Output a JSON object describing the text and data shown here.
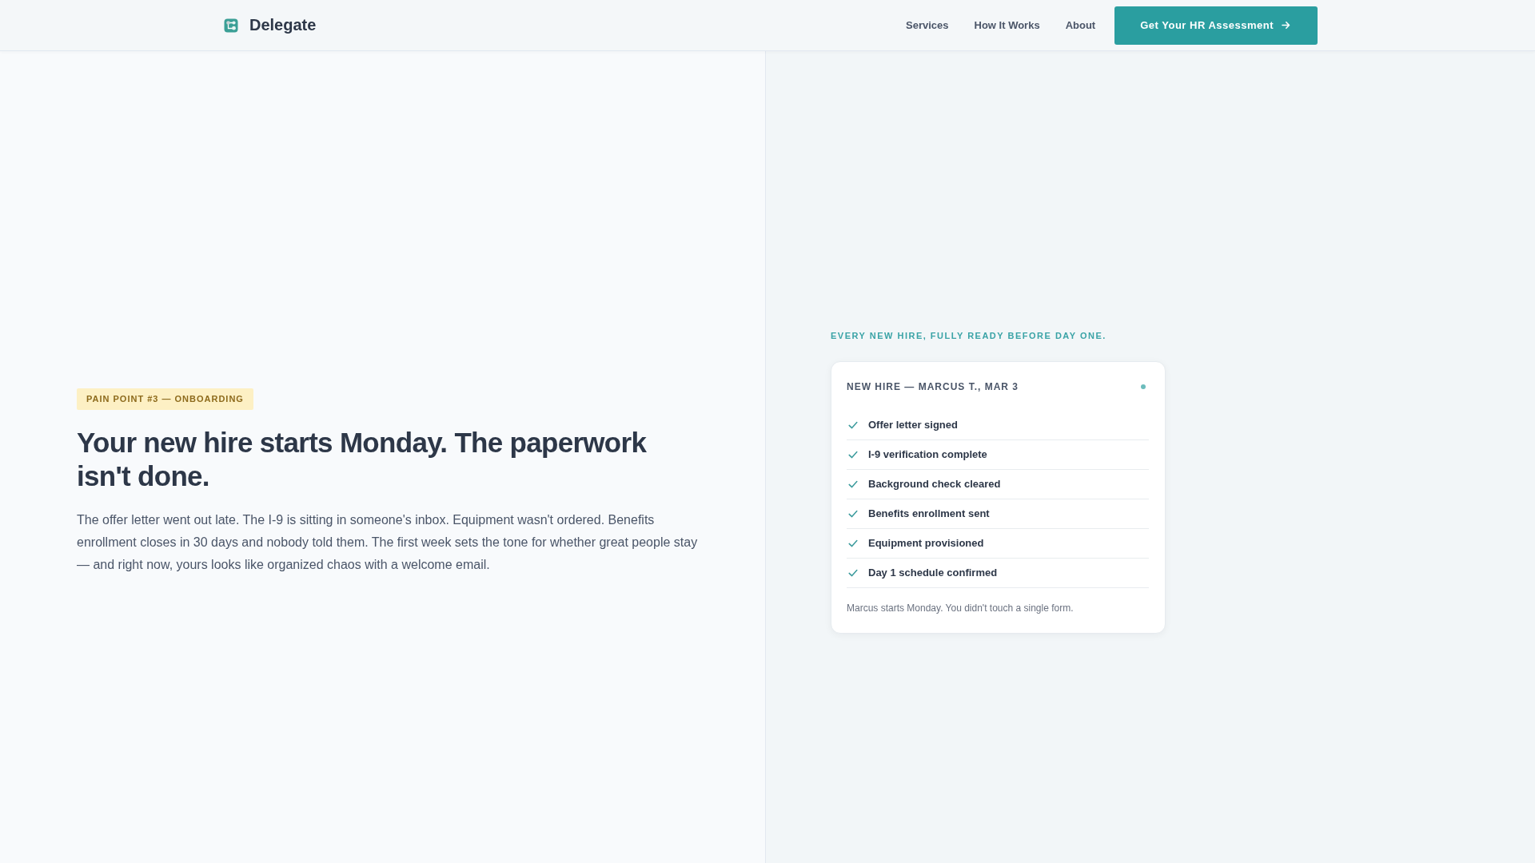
{
  "header": {
    "brand": "Delegate",
    "nav": [
      {
        "label": "Services"
      },
      {
        "label": "How It Works"
      },
      {
        "label": "About"
      }
    ],
    "cta": {
      "label": "Get Your HR Assessment"
    }
  },
  "hero": {
    "badge": "PAIN POINT #3 — ONBOARDING",
    "headline": "Your new hire starts Monday. The paperwork isn't done.",
    "body": "The offer letter went out late. The I-9 is sitting in someone's inbox. Equipment wasn't ordered. Benefits enrollment closes in 30 days and nobody told them. The first week sets the tone for whether great people stay — and right now, yours looks like organized chaos with a welcome email."
  },
  "panel": {
    "tagline": "EVERY NEW HIRE, FULLY READY BEFORE DAY ONE.",
    "card": {
      "title": "NEW HIRE — MARCUS T., MAR 3",
      "items": [
        {
          "label": "Offer letter signed",
          "checked": true
        },
        {
          "label": "I-9 verification complete",
          "checked": true
        },
        {
          "label": "Background check cleared",
          "checked": true
        },
        {
          "label": "Benefits enrollment sent",
          "checked": true
        },
        {
          "label": "Equipment provisioned",
          "checked": true
        },
        {
          "label": "Day 1 schedule confirmed",
          "checked": true
        }
      ],
      "footer": "Marcus starts Monday. You didn't touch a single form."
    }
  }
}
